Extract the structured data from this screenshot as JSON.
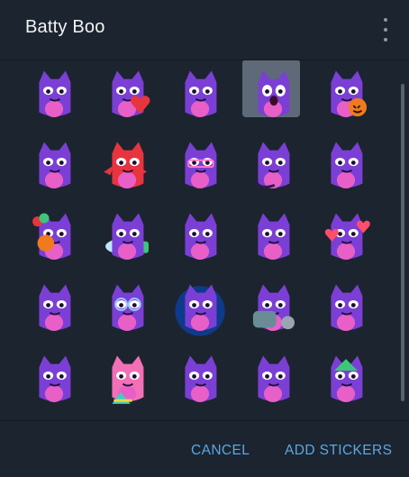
{
  "dialog": {
    "title": "Batty Boo"
  },
  "footer": {
    "cancel_label": "CANCEL",
    "add_label": "ADD STICKERS"
  },
  "colors": {
    "background": "#1c242f",
    "accent": "#5aa8e4",
    "bat_purple": "#7b3fd6",
    "bat_belly": "#e85fc8"
  },
  "stickers": [
    {
      "name": "sticker-bat-floating-happy"
    },
    {
      "name": "sticker-bat-red-heart"
    },
    {
      "name": "sticker-bat-thumbs-up"
    },
    {
      "name": "sticker-bat-shocked-selected"
    },
    {
      "name": "sticker-bat-pumpkin"
    },
    {
      "name": "sticker-bat-unimpressed-closeup"
    },
    {
      "name": "sticker-bat-red-angry"
    },
    {
      "name": "sticker-bat-pink-glasses"
    },
    {
      "name": "sticker-bat-devil-tail"
    },
    {
      "name": "sticker-bat-starry-eyes"
    },
    {
      "name": "sticker-bat-balloons-pumpkin"
    },
    {
      "name": "sticker-bat-pillow-sleep"
    },
    {
      "name": "sticker-bat-with-bag"
    },
    {
      "name": "sticker-bat-squint"
    },
    {
      "name": "sticker-bat-hearts"
    },
    {
      "name": "sticker-bat-mushroom-sweat"
    },
    {
      "name": "sticker-bat-round-glasses"
    },
    {
      "name": "sticker-bat-hanging-night"
    },
    {
      "name": "sticker-bat-for-you-sign"
    },
    {
      "name": "sticker-bat-smug"
    },
    {
      "name": "sticker-bat-hiding-face"
    },
    {
      "name": "sticker-bat-pink-rainbow"
    },
    {
      "name": "sticker-bat-surprised"
    },
    {
      "name": "sticker-bat-lying-sad"
    },
    {
      "name": "sticker-bat-green-hat"
    }
  ]
}
